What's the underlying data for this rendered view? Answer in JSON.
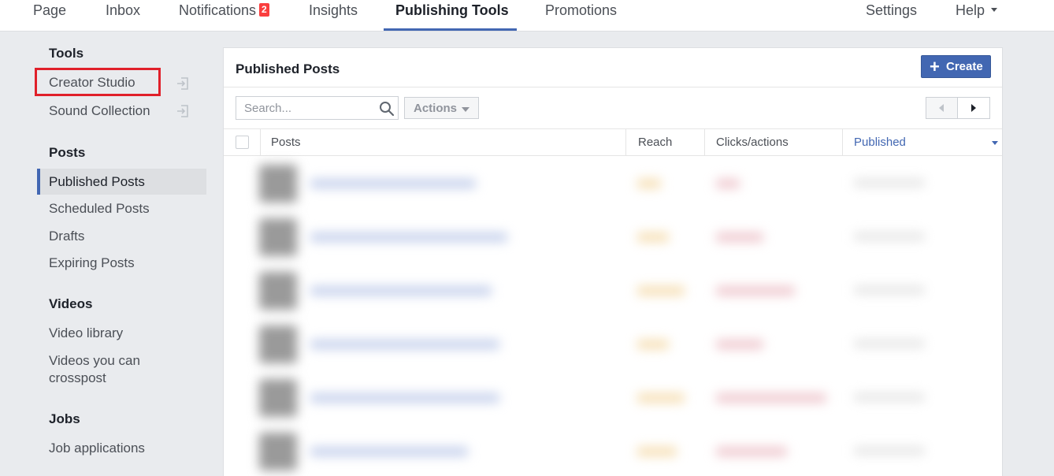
{
  "nav": {
    "items": [
      {
        "label": "Page"
      },
      {
        "label": "Inbox"
      },
      {
        "label": "Notifications",
        "badge": "2"
      },
      {
        "label": "Insights"
      },
      {
        "label": "Publishing Tools",
        "active": true
      },
      {
        "label": "Promotions"
      }
    ],
    "settings": "Settings",
    "help": "Help"
  },
  "sidebar": {
    "tools_heading": "Tools",
    "tools": [
      "Creator Studio",
      "Sound Collection"
    ],
    "posts_heading": "Posts",
    "posts": [
      "Published Posts",
      "Scheduled Posts",
      "Drafts",
      "Expiring Posts"
    ],
    "videos_heading": "Videos",
    "videos": [
      "Video library",
      "Videos you can crosspost"
    ],
    "jobs_heading": "Jobs",
    "jobs": [
      "Job applications"
    ],
    "active_item": "Published Posts"
  },
  "main": {
    "title": "Published Posts",
    "create_label": "Create",
    "search_placeholder": "Search...",
    "actions_label": "Actions",
    "columns": [
      "Posts",
      "Reach",
      "Clicks/actions",
      "Published"
    ],
    "sorted_column": "Published"
  },
  "colors": {
    "accent": "#4267b2",
    "badge": "#fa3e3e",
    "highlight": "#e0202a"
  }
}
